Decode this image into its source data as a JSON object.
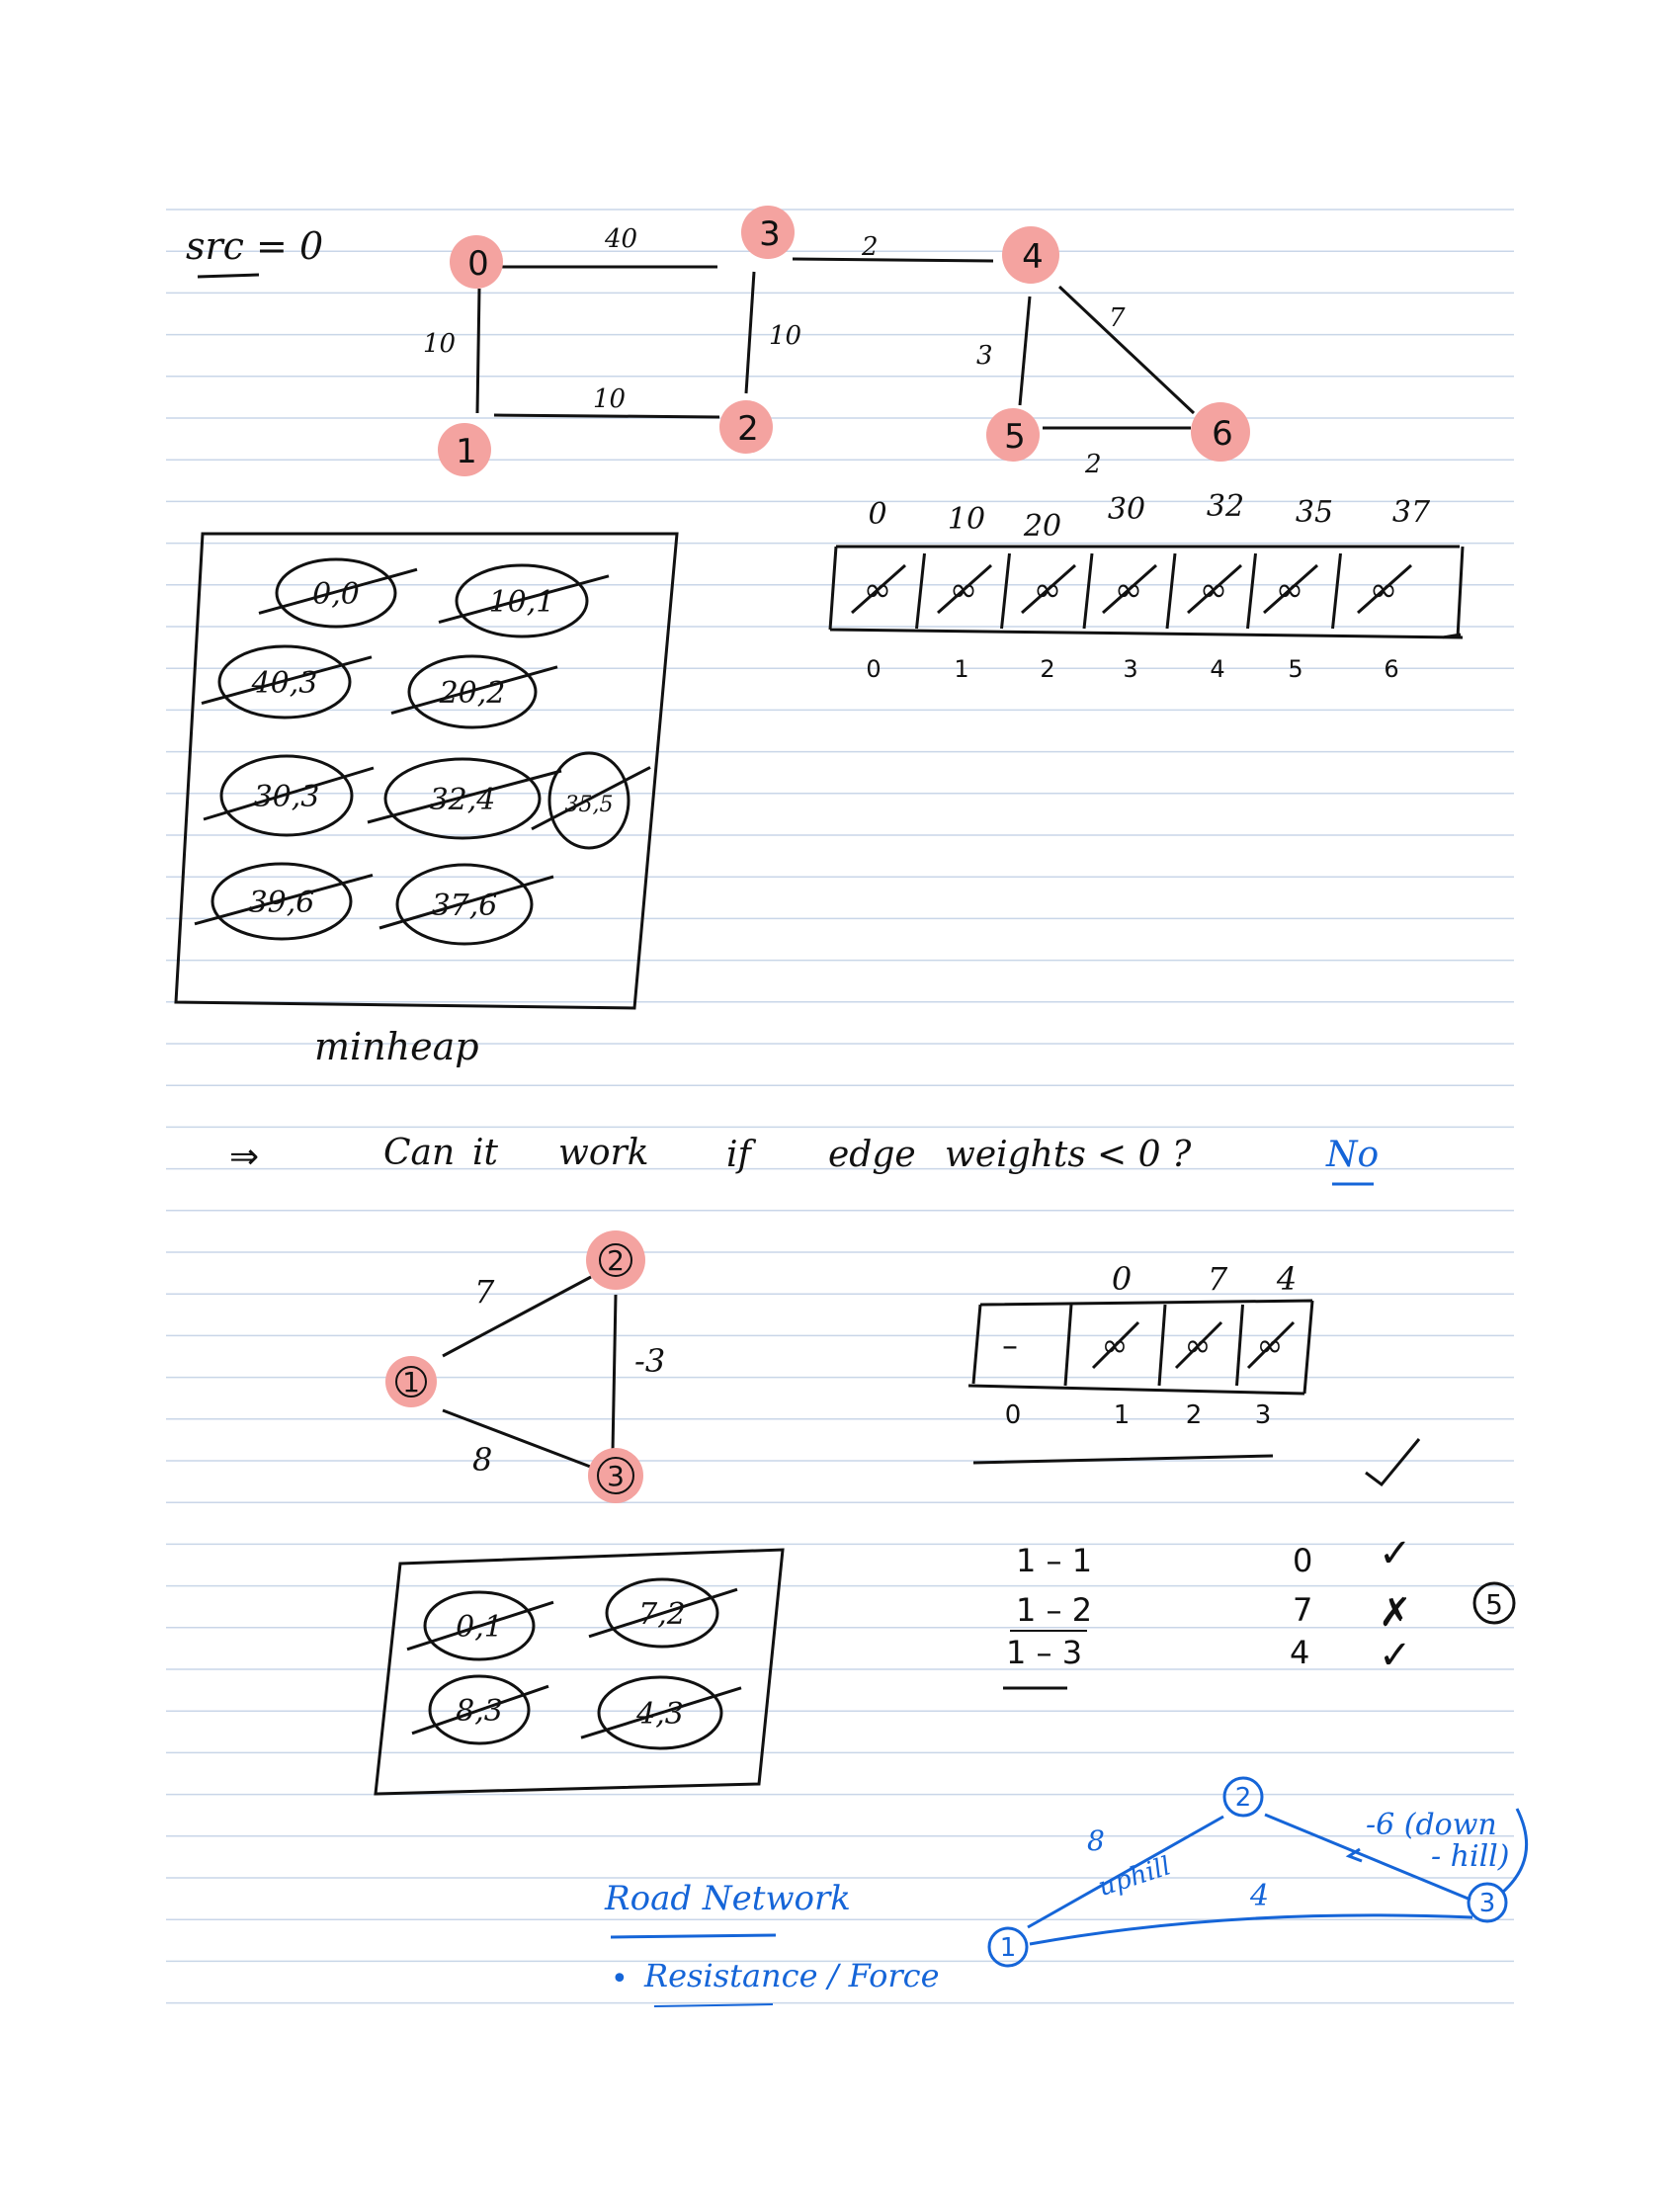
{
  "colors": {
    "ink": "#111111",
    "blue": "#1565d8",
    "highlight": "#f4a3a0",
    "rule": "#c9d6e8"
  },
  "src_label": "src = 0",
  "graph1": {
    "nodes": [
      "0",
      "1",
      "2",
      "3",
      "4",
      "5",
      "6"
    ],
    "edge_weights": [
      "40",
      "10",
      "10",
      "10",
      "2",
      "3",
      "7",
      "2"
    ]
  },
  "dist_table": {
    "values_above": [
      "0",
      "10",
      "20",
      "30",
      "32",
      "35",
      "37"
    ],
    "cells": [
      "∞",
      "∞",
      "∞",
      "∞",
      "∞",
      "∞",
      "∞"
    ],
    "indices": [
      "0",
      "1",
      "2",
      "3",
      "4",
      "5",
      "6"
    ]
  },
  "minheap": {
    "label": "minheap",
    "items": [
      "0,0",
      "10,1",
      "40,3",
      "20,2",
      "30,3",
      "32,4",
      "35,5",
      "39,6",
      "37,6"
    ]
  },
  "question": {
    "arrow": "⇒",
    "words": [
      "Can",
      "it",
      "work",
      "if",
      "edge",
      "weights",
      "< 0 ?"
    ],
    "answer": "No"
  },
  "graph2": {
    "nodes": [
      "1",
      "2",
      "3"
    ],
    "edge_weights": [
      "7",
      "-3",
      "8"
    ]
  },
  "dist_table2": {
    "values_above": [
      "0",
      "7",
      "4"
    ],
    "cells": [
      "–",
      "∞",
      "∞",
      "∞"
    ],
    "indices": [
      "0",
      "1",
      "2",
      "3"
    ]
  },
  "paths": {
    "rows": [
      {
        "path": "1 – 1",
        "dist": "0",
        "mark": "✓"
      },
      {
        "path": "1 – 2",
        "dist": "7",
        "mark": "✗"
      },
      {
        "path": "1 – 3",
        "dist": "4",
        "mark": "✓"
      }
    ],
    "circled_note": "5"
  },
  "minheap2": {
    "items": [
      "0,1",
      "7,2",
      "8,3",
      "4,3"
    ]
  },
  "road_network": {
    "title": "Road Network",
    "bullet": "Resistance / Force",
    "nodes": [
      "1",
      "2",
      "3"
    ],
    "edge_labels": [
      "8",
      "uphill",
      "-6 (down",
      "- hill)",
      "4"
    ]
  }
}
